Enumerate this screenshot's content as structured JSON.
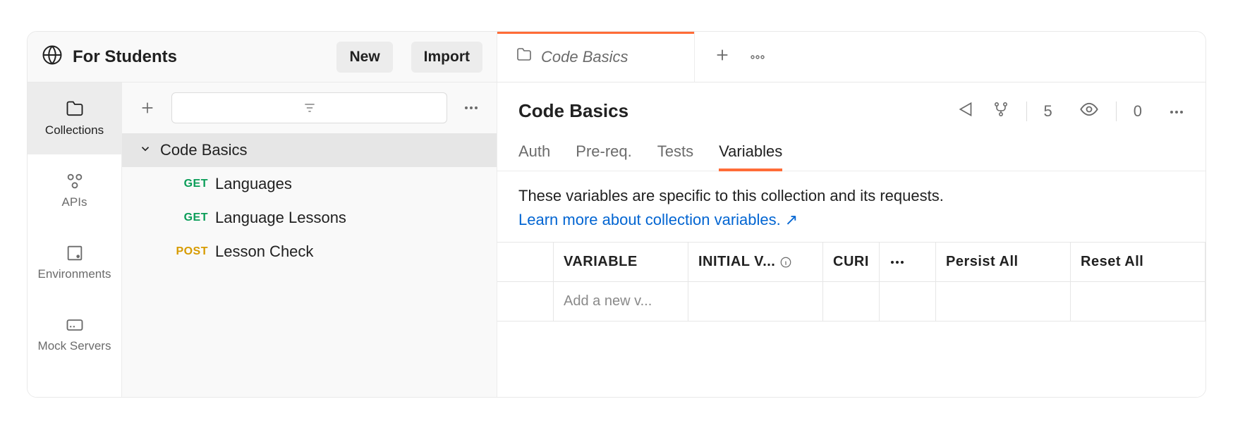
{
  "workspace": {
    "name": "For Students",
    "new_btn": "New",
    "import_btn": "Import"
  },
  "tabs": {
    "active_label": "Code Basics"
  },
  "sidebar": {
    "items": [
      {
        "label": "Collections"
      },
      {
        "label": "APIs"
      },
      {
        "label": "Environments"
      },
      {
        "label": "Mock Servers"
      }
    ]
  },
  "tree": {
    "collection_name": "Code Basics",
    "requests": [
      {
        "method": "GET",
        "name": "Languages"
      },
      {
        "method": "GET",
        "name": "Language Lessons"
      },
      {
        "method": "POST",
        "name": "Lesson Check"
      }
    ]
  },
  "main": {
    "title": "Code Basics",
    "fork_count": "5",
    "watch_count": "0",
    "subtabs": [
      "Auth",
      "Pre-req.",
      "Tests",
      "Variables"
    ],
    "variables_desc": "These variables are specific to this collection and its requests.",
    "variables_link": "Learn more about collection variables.",
    "table": {
      "headers": {
        "variable": "VARIABLE",
        "initial": "INITIAL V...",
        "current": "CURI",
        "persist": "Persist All",
        "reset": "Reset All"
      },
      "placeholder": "Add a new v..."
    }
  }
}
